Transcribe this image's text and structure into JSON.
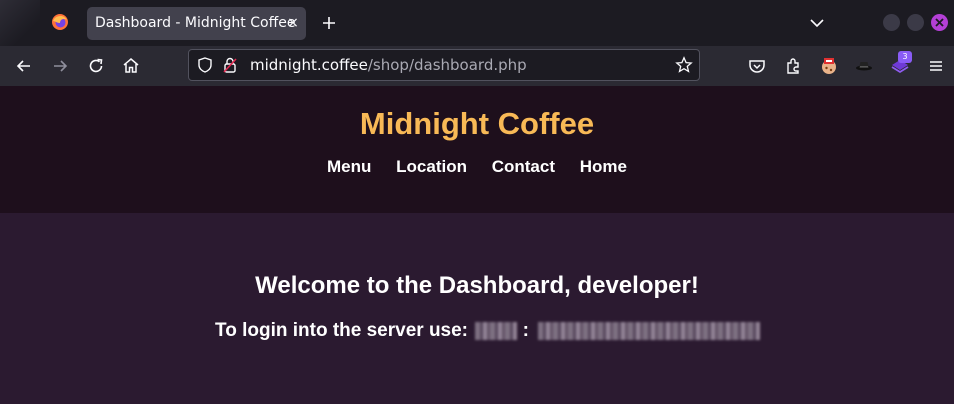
{
  "browser": {
    "tab_title": "Dashboard - Midnight Coffee",
    "tab_close": "×",
    "url_host": "midnight.coffee",
    "url_path": "/shop/dashboard.php",
    "extension_badge": "3"
  },
  "site": {
    "title": "Midnight Coffee",
    "nav": [
      "Menu",
      "Location",
      "Contact",
      "Home"
    ]
  },
  "dashboard": {
    "welcome": "Welcome to the Dashboard, developer!",
    "login_prefix": "To login into the server use:",
    "separator": ":"
  },
  "colors": {
    "title_accent": "#f8b956",
    "header_bg": "#1e0f1c",
    "main_bg": "#2b1a30"
  }
}
